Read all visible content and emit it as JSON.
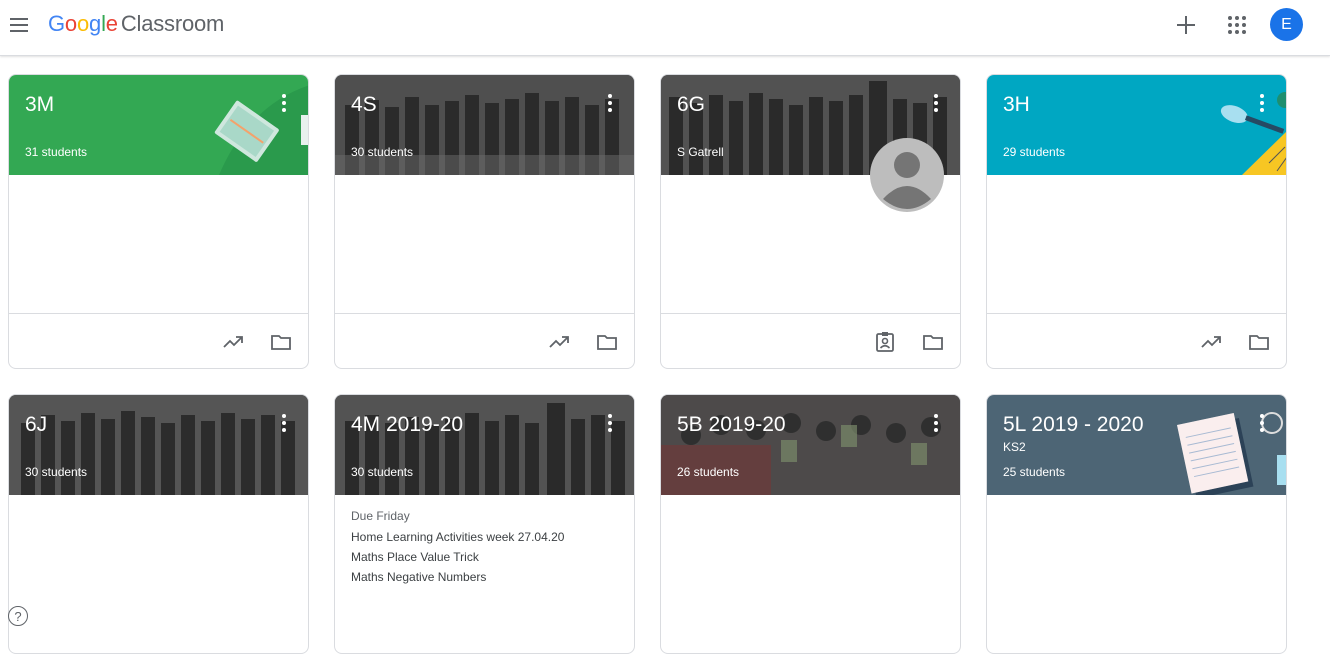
{
  "header": {
    "brand_letters": [
      "G",
      "o",
      "o",
      "g",
      "l",
      "e"
    ],
    "product": "Classroom",
    "avatar_letter": "E",
    "icons": [
      "menu-icon",
      "plus-icon",
      "apps-grid-icon"
    ]
  },
  "classes": [
    {
      "name": "3M",
      "subtitle": "31 students",
      "theme_color": "#33a853",
      "theme": "green-books"
    },
    {
      "name": "4S",
      "subtitle": "30 students",
      "theme": "photo"
    },
    {
      "name": "6G",
      "subtitle": "S Gatrell",
      "theme": "photo"
    },
    {
      "name": "3H",
      "subtitle": "29 students",
      "theme_color": "#00a7c2",
      "theme": "teal-geometry"
    },
    {
      "name": "6J",
      "subtitle": "30 students",
      "theme": "photo"
    },
    {
      "name": "4M 2019-20",
      "subtitle": "30 students",
      "theme": "photo",
      "due_label": "Due Friday",
      "assignments": [
        "Home Learning Activities week 27.04.20",
        "Maths Place Value Trick",
        "Maths Negative Numbers"
      ]
    },
    {
      "name": "5B 2019-20",
      "subtitle": "26 students",
      "theme": "photo"
    },
    {
      "name": "5L 2019 - 2020",
      "section": "KS2",
      "subtitle": "25 students",
      "theme_color": "#4d6575",
      "theme": "slate-notebook"
    }
  ],
  "help_glyph": "?"
}
